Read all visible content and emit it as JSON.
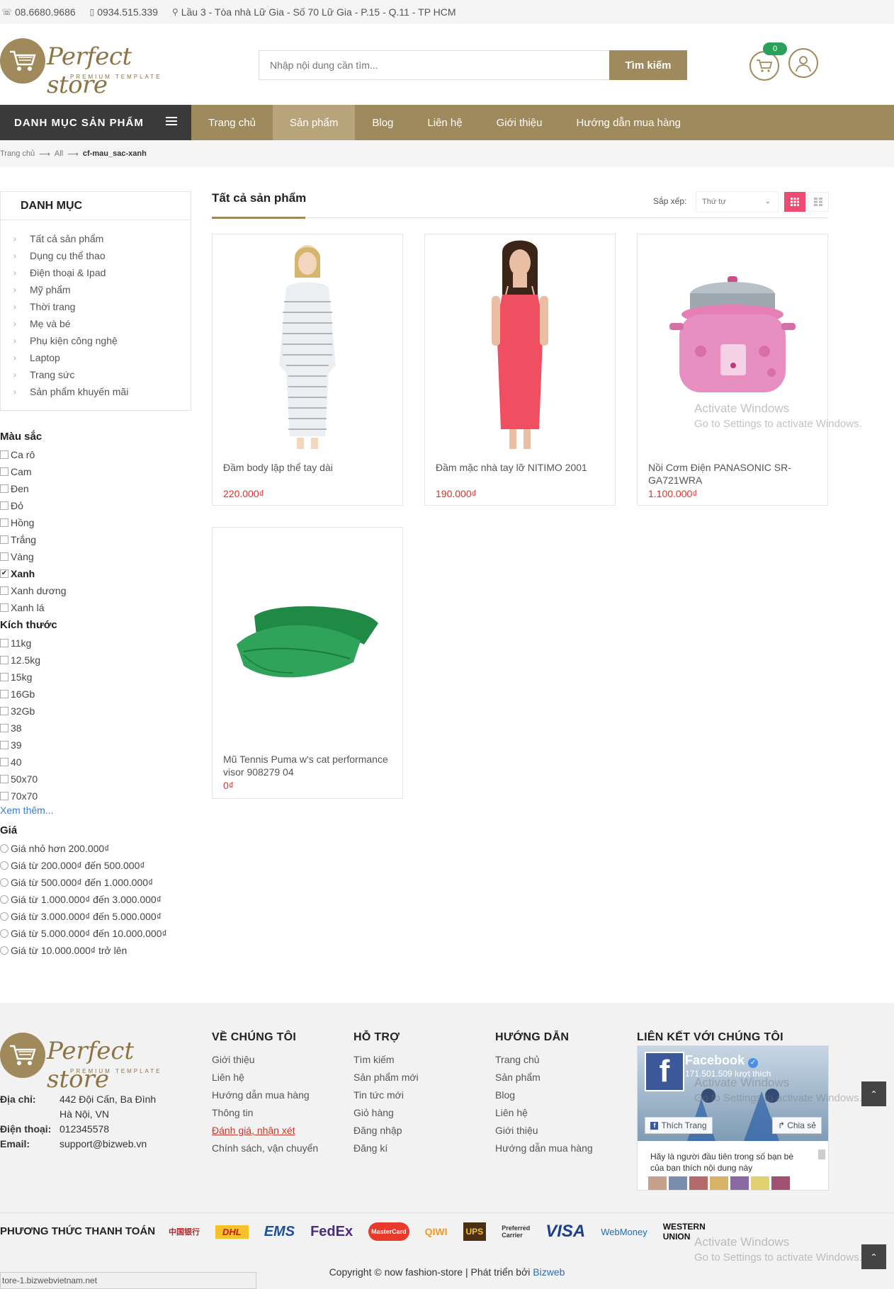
{
  "topbar": {
    "phone1": "08.6680.9686",
    "phone2": "0934.515.339",
    "address": "Lầu 3 - Tòa nhà Lữ Gia - Số 70 Lữ Gia - P.15 - Q.11 - TP HCM"
  },
  "header": {
    "logo_text": "Perfect store",
    "logo_sub": "PREMIUM TEMPLATE",
    "search_placeholder": "Nhập nội dung cần tìm...",
    "search_button": "Tìm kiếm",
    "cart_count": "0"
  },
  "nav": {
    "category_label": "DANH MỤC SẢN PHẨM",
    "links": [
      "Trang chủ",
      "Sản phẩm",
      "Blog",
      "Liên hệ",
      "Giới thiệu",
      "Hướng dẫn mua hàng"
    ],
    "active": "Sản phẩm"
  },
  "breadcrumb": {
    "home": "Trang chủ",
    "level2": "All",
    "current": "cf-mau_sac-xanh"
  },
  "sidebar": {
    "category_title": "DANH MỤC",
    "categories": [
      "Tất cả sản phẩm",
      "Dụng cụ thể thao",
      "Điện thoại & Ipad",
      "Mỹ phẩm",
      "Thời trang",
      "Mẹ và bé",
      "Phụ kiện công nghệ",
      "Laptop",
      "Trang sức",
      "Sản phẩm khuyến mãi"
    ],
    "color_title": "Màu sắc",
    "colors": [
      "Ca rô",
      "Cam",
      "Đen",
      "Đỏ",
      "Hồng",
      "Trắng",
      "Vàng",
      "Xanh",
      "Xanh dương",
      "Xanh lá"
    ],
    "color_checked": "Xanh",
    "size_title": "Kích thước",
    "sizes": [
      "11kg",
      "12.5kg",
      "15kg",
      "16Gb",
      "32Gb",
      "38",
      "39",
      "40",
      "50x70",
      "70x70"
    ],
    "see_more": "Xem thêm...",
    "price_title": "Giá",
    "prices": [
      "Giá nhỏ hơn 200.000₫",
      "Giá từ 200.000₫ đến 500.000₫",
      "Giá từ 500.000₫ đến 1.000.000₫",
      "Giá từ 1.000.000₫ đến 3.000.000₫",
      "Giá từ 3.000.000₫ đến 5.000.000₫",
      "Giá từ 5.000.000₫ đến 10.000.000₫",
      "Giá từ 10.000.000₫ trở lên"
    ]
  },
  "main": {
    "title": "Tất cả sản phẩm",
    "sort_label": "Sắp xếp:",
    "sort_value": "Thứ tự",
    "products": [
      {
        "name": "Đầm body lập thể tay dài",
        "price": "220.000₫"
      },
      {
        "name": "Đầm mặc nhà tay lỡ NITIMO 2001",
        "price": "190.000₫"
      },
      {
        "name": "Nồi Cơm Điện PANASONIC SR-GA721WRA",
        "price": "1.100.000₫"
      },
      {
        "name": "Mũ Tennis Puma w's cat performance visor 908279 04",
        "price": "0₫"
      }
    ]
  },
  "footer": {
    "address_label": "Địa chỉ:",
    "address_line1": "442 Đội Cấn, Ba Đình",
    "address_line2": "Hà Nội, VN",
    "phone_label": "Điện thoại:",
    "phone": "012345578",
    "email_label": "Email:",
    "email": "support@bizweb.vn",
    "col1_title": "VỀ CHÚNG TÔI",
    "col1_links": [
      "Giới thiệu",
      "Liên hệ",
      "Hướng dẫn mua hàng",
      "Thông tin",
      "Đánh giá, nhận xét",
      "Chính sách, vận chuyển"
    ],
    "col2_title": "HỖ TRỢ",
    "col2_links": [
      "Tìm kiếm",
      "Sản phẩm mới",
      "Tin tức mới",
      "Giỏ hàng",
      "Đăng nhập",
      "Đăng kí"
    ],
    "col3_title": "HƯỚNG DẪN",
    "col3_links": [
      "Trang chủ",
      "Sản phẩm",
      "Blog",
      "Liên hệ",
      "Giới thiệu",
      "Hướng dẫn mua hàng"
    ],
    "col4_title": "LIÊN KẾT VỚI CHÚNG TÔI",
    "fb_name": "Facebook",
    "fb_likes": "171.501.509 lượt thích",
    "fb_like": "Thích Trang",
    "fb_share": "Chia sẻ",
    "fb_msg": "Hãy là người đầu tiên trong số bạn bè của bạn thích nội dung này",
    "payment_title": "PHƯƠNG THỨC THANH TOÁN",
    "payment_logos": [
      "中国银行",
      "DHL",
      "EMS",
      "FedEx",
      "MasterCard",
      "QIWI",
      "UPS",
      "Preferred Carrier",
      "VISA",
      "WebMoney",
      "WESTERN UNION"
    ],
    "copyright": "Copyright © now fashion-store | Phát triển bởi",
    "copyright_brand": "Bizweb"
  },
  "status_url": "tore-1.bizwebvietnam.net",
  "watermark": {
    "line1": "Activate Windows",
    "line2": "Go to Settings to activate Windows."
  },
  "colors": {
    "accent": "#9e8a5c",
    "dark": "#3a3a3a",
    "price": "#e0302a",
    "view_active": "#ef4a72"
  }
}
